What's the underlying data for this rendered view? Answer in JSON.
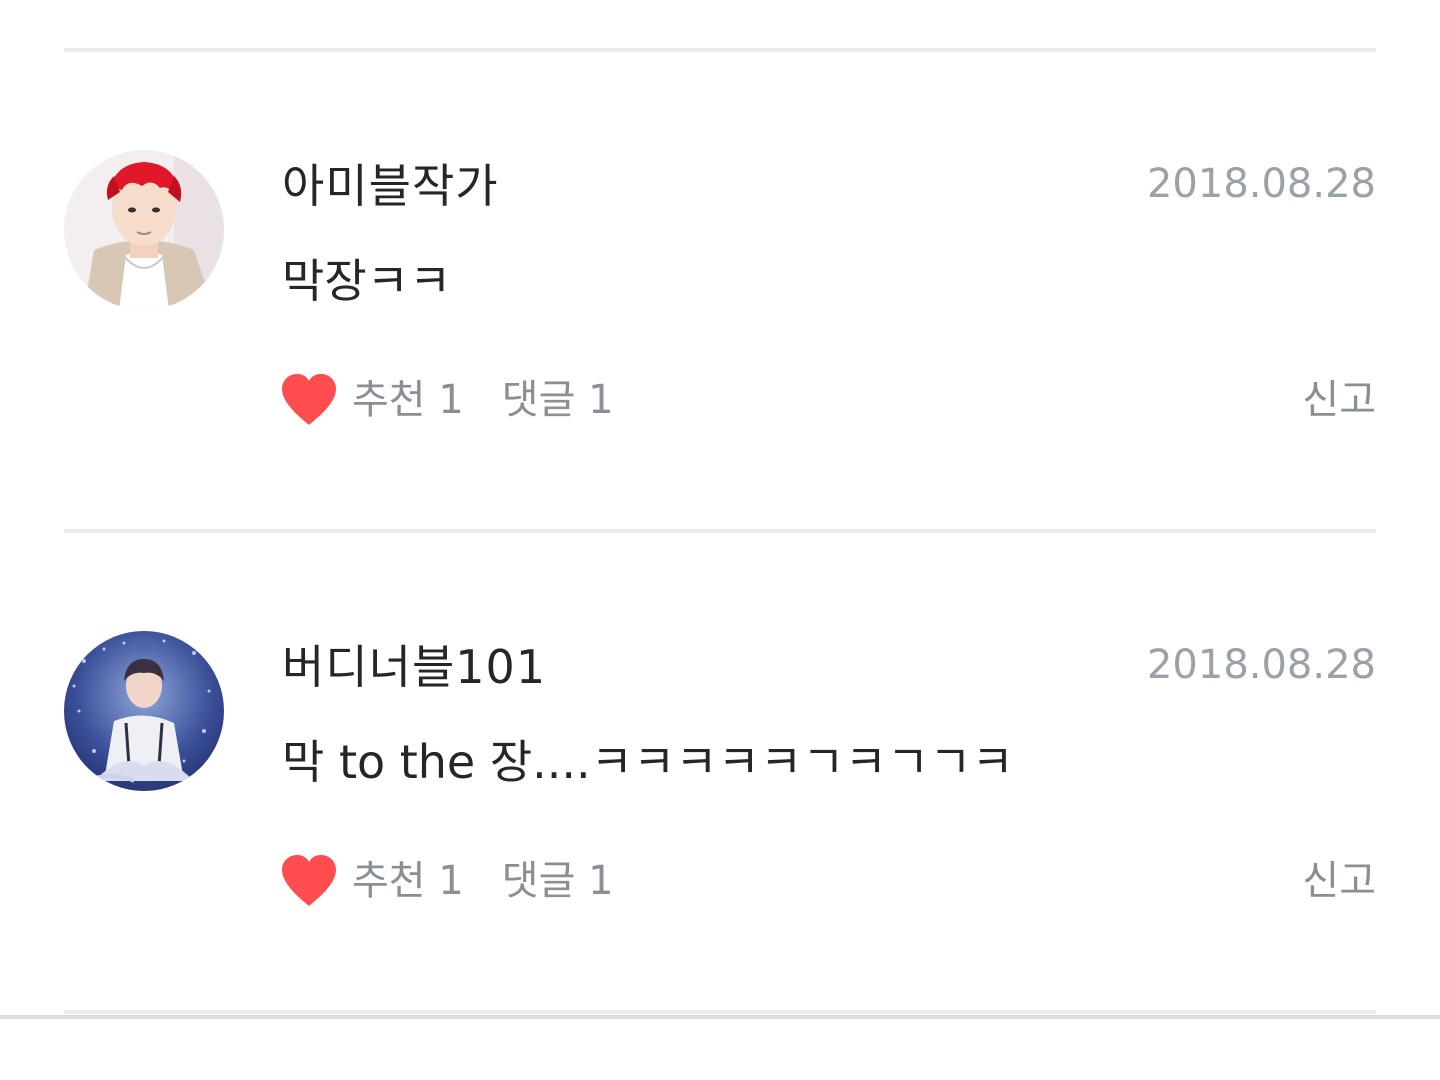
{
  "comments": [
    {
      "author": "아미블작가",
      "date": "2018.08.28",
      "text": "막장ㅋㅋ",
      "like_label": "추천 1",
      "reply_label": "댓글 1",
      "report_label": "신고",
      "avatar_icon": "avatar-red-hair-portrait",
      "heart_icon": "heart-icon",
      "heart_color": "#ff4d4f"
    },
    {
      "author": "버디너블101",
      "date": "2018.08.28",
      "text": "막 to the 장....ㅋㅋㅋㅋㅋㄱㅋㄱㄱㅋ",
      "like_label": "추천 1",
      "reply_label": "댓글 1",
      "report_label": "신고",
      "avatar_icon": "avatar-blue-stage-portrait",
      "heart_icon": "heart-icon",
      "heart_color": "#ff4d4f"
    }
  ]
}
